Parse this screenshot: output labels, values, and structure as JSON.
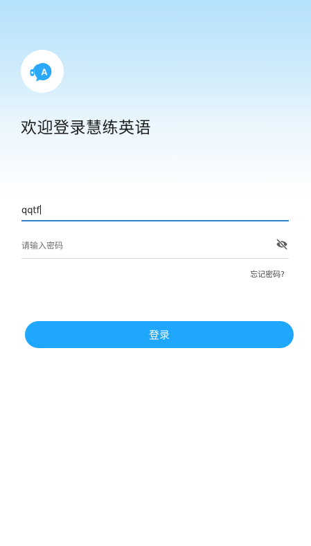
{
  "app": {
    "logo_icon": "headset-speech-bubble-icon",
    "logo_letter": "A",
    "welcome_title": "欢迎登录慧练英语"
  },
  "form": {
    "username_value": "qqtf",
    "password_placeholder": "请输入密码",
    "password_toggle_icon": "eye-off-icon",
    "forgot_password_label": "忘记密码?",
    "login_button_label": "登录"
  },
  "colors": {
    "header_gradient_top": "#b3e1fb",
    "accent": "#1fa7fe",
    "focus_underline": "#2f7fd4",
    "logo_blue": "#29a9f8"
  }
}
